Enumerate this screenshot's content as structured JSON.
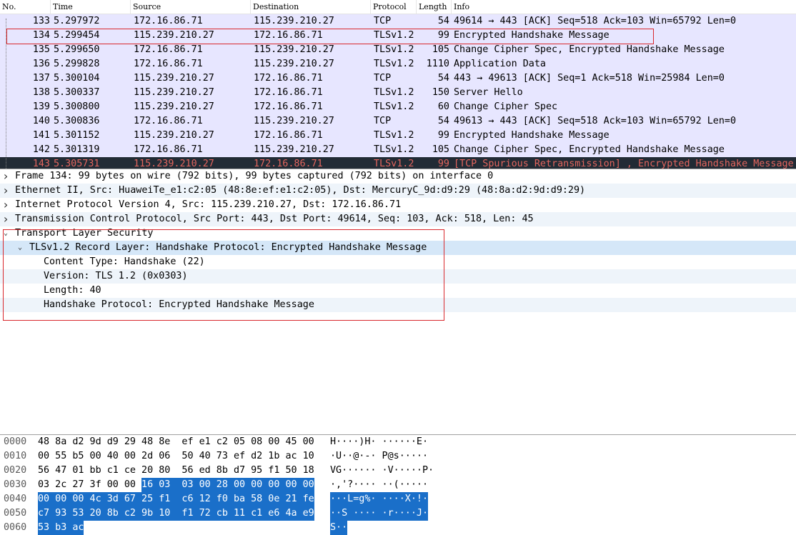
{
  "packet_list": {
    "columns": [
      "No.",
      "Time",
      "Source",
      "Destination",
      "Protocol",
      "Length",
      "Info"
    ],
    "rows": [
      {
        "no": "133",
        "time": "5.297972",
        "src": "172.16.86.71",
        "dst": "115.239.210.27",
        "proto": "TCP",
        "len": "54",
        "info": "49614 → 443 [ACK] Seq=518 Ack=103 Win=65792 Len=0"
      },
      {
        "no": "134",
        "time": "5.299454",
        "src": "115.239.210.27",
        "dst": "172.16.86.71",
        "proto": "TLSv1.2",
        "len": "99",
        "info": "Encrypted Handshake Message"
      },
      {
        "no": "135",
        "time": "5.299650",
        "src": "172.16.86.71",
        "dst": "115.239.210.27",
        "proto": "TLSv1.2",
        "len": "105",
        "info": "Change Cipher Spec, Encrypted Handshake Message"
      },
      {
        "no": "136",
        "time": "5.299828",
        "src": "172.16.86.71",
        "dst": "115.239.210.27",
        "proto": "TLSv1.2",
        "len": "1110",
        "info": "Application Data"
      },
      {
        "no": "137",
        "time": "5.300104",
        "src": "115.239.210.27",
        "dst": "172.16.86.71",
        "proto": "TCP",
        "len": "54",
        "info": "443 → 49613 [ACK] Seq=1 Ack=518 Win=25984 Len=0"
      },
      {
        "no": "138",
        "time": "5.300337",
        "src": "115.239.210.27",
        "dst": "172.16.86.71",
        "proto": "TLSv1.2",
        "len": "150",
        "info": "Server Hello"
      },
      {
        "no": "139",
        "time": "5.300800",
        "src": "115.239.210.27",
        "dst": "172.16.86.71",
        "proto": "TLSv1.2",
        "len": "60",
        "info": "Change Cipher Spec"
      },
      {
        "no": "140",
        "time": "5.300836",
        "src": "172.16.86.71",
        "dst": "115.239.210.27",
        "proto": "TCP",
        "len": "54",
        "info": "49613 → 443 [ACK] Seq=518 Ack=103 Win=65792 Len=0"
      },
      {
        "no": "141",
        "time": "5.301152",
        "src": "115.239.210.27",
        "dst": "172.16.86.71",
        "proto": "TLSv1.2",
        "len": "99",
        "info": "Encrypted Handshake Message"
      },
      {
        "no": "142",
        "time": "5.301319",
        "src": "172.16.86.71",
        "dst": "115.239.210.27",
        "proto": "TLSv1.2",
        "len": "105",
        "info": "Change Cipher Spec, Encrypted Handshake Message"
      },
      {
        "no": "143",
        "time": "5.305731",
        "src": "115.239.210.27",
        "dst": "172.16.86.71",
        "proto": "TLSv1.2",
        "len": "99",
        "info": "[TCP Spurious Retransmission] , Encrypted Handshake Message"
      }
    ]
  },
  "details": [
    {
      "text": "Frame 134: 99 bytes on wire (792 bits), 99 bytes captured (792 bits) on interface 0",
      "level": 0,
      "expander": "collapsed"
    },
    {
      "text": "Ethernet II, Src: HuaweiTe_e1:c2:05 (48:8e:ef:e1:c2:05), Dst: MercuryC_9d:d9:29 (48:8a:d2:9d:d9:29)",
      "level": 0,
      "expander": "collapsed"
    },
    {
      "text": "Internet Protocol Version 4, Src: 115.239.210.27, Dst: 172.16.86.71",
      "level": 0,
      "expander": "collapsed"
    },
    {
      "text": "Transmission Control Protocol, Src Port: 443, Dst Port: 49614, Seq: 103, Ack: 518, Len: 45",
      "level": 0,
      "expander": "collapsed"
    },
    {
      "text": "Transport Layer Security",
      "level": 0,
      "expander": "expanded"
    },
    {
      "text": "TLSv1.2 Record Layer: Handshake Protocol: Encrypted Handshake Message",
      "level": 1,
      "expander": "expanded"
    },
    {
      "text": "Content Type: Handshake (22)",
      "level": 2,
      "expander": "none"
    },
    {
      "text": "Version: TLS 1.2 (0x0303)",
      "level": 2,
      "expander": "none"
    },
    {
      "text": "Length: 40",
      "level": 2,
      "expander": "none"
    },
    {
      "text": "Handshake Protocol: Encrypted Handshake Message",
      "level": 2,
      "expander": "none"
    }
  ],
  "bytes": [
    {
      "offset": "0000",
      "hex": [
        "48",
        "8a",
        "d2",
        "9d",
        "d9",
        "29",
        "48",
        "8e",
        "ef",
        "e1",
        "c2",
        "05",
        "08",
        "00",
        "45",
        "00"
      ],
      "ascii": "H····)H· ······E·"
    },
    {
      "offset": "0010",
      "hex": [
        "00",
        "55",
        "b5",
        "00",
        "40",
        "00",
        "2d",
        "06",
        "50",
        "40",
        "73",
        "ef",
        "d2",
        "1b",
        "ac",
        "10"
      ],
      "ascii": "·U··@·-· P@s·····"
    },
    {
      "offset": "0020",
      "hex": [
        "56",
        "47",
        "01",
        "bb",
        "c1",
        "ce",
        "20",
        "80",
        "56",
        "ed",
        "8b",
        "d7",
        "95",
        "f1",
        "50",
        "18"
      ],
      "ascii": "VG······ ·V·····P·"
    },
    {
      "offset": "0030",
      "hex": [
        "03",
        "2c",
        "27",
        "3f",
        "00",
        "00",
        "16",
        "03",
        "03",
        "00",
        "28",
        "00",
        "00",
        "00",
        "00",
        "00"
      ],
      "ascii": "·,'?···· ··(·····"
    },
    {
      "offset": "0040",
      "hex": [
        "00",
        "00",
        "00",
        "4c",
        "3d",
        "67",
        "25",
        "f1",
        "c6",
        "12",
        "f0",
        "ba",
        "58",
        "0e",
        "21",
        "fe"
      ],
      "ascii": "···L=g%· ····X·!·"
    },
    {
      "offset": "0050",
      "hex": [
        "c7",
        "93",
        "53",
        "20",
        "8b",
        "c2",
        "9b",
        "10",
        "f1",
        "72",
        "cb",
        "11",
        "c1",
        "e6",
        "4a",
        "e9"
      ],
      "ascii": "··S ···· ·r····J·"
    },
    {
      "offset": "0060",
      "hex": [
        "53",
        "b3",
        "ac"
      ],
      "ascii": "S··"
    }
  ]
}
